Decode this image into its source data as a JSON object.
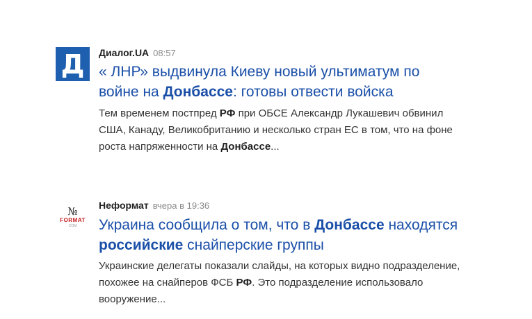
{
  "items": [
    {
      "source": "Диалог.UA",
      "time": "08:57",
      "logo_letter": "Д",
      "headline": {
        "p1": "« ЛНР» выдвинула Киеву новый ультиматум по войне на ",
        "b1": "Донбассе",
        "p2": ": готовы отвести войска"
      },
      "snippet": {
        "p1": "Тем временем постпред ",
        "b1": "РФ",
        "p2": " при ОБСЕ Александр Лукашевич обвинил США, Канаду, Великобританию и несколько стран ЕС в том, что на фоне роста напряженности на ",
        "b2": "Донбассе",
        "p3": "..."
      }
    },
    {
      "source": "Неформат",
      "time": "вчера в 19:36",
      "logo": {
        "no": "№",
        "format": "FORMAT",
        "com": "COM"
      },
      "headline": {
        "p1": "Украина сообщила о том, что в ",
        "b1": "Донбассе",
        "p2": " находятся ",
        "b2": "российские",
        "p3": " снайперские группы"
      },
      "snippet": {
        "p1": "Украинские делегаты показали слайды, на которых видно подразделение, похожее на снайперов ФСБ ",
        "b1": "РФ",
        "p2": ". Это подразделение использовало вооружение..."
      }
    }
  ],
  "colors": {
    "link": "#1a4fa8",
    "dialog_logo_bg": "#1f5fb0",
    "neformat_red": "#c81d1d"
  }
}
